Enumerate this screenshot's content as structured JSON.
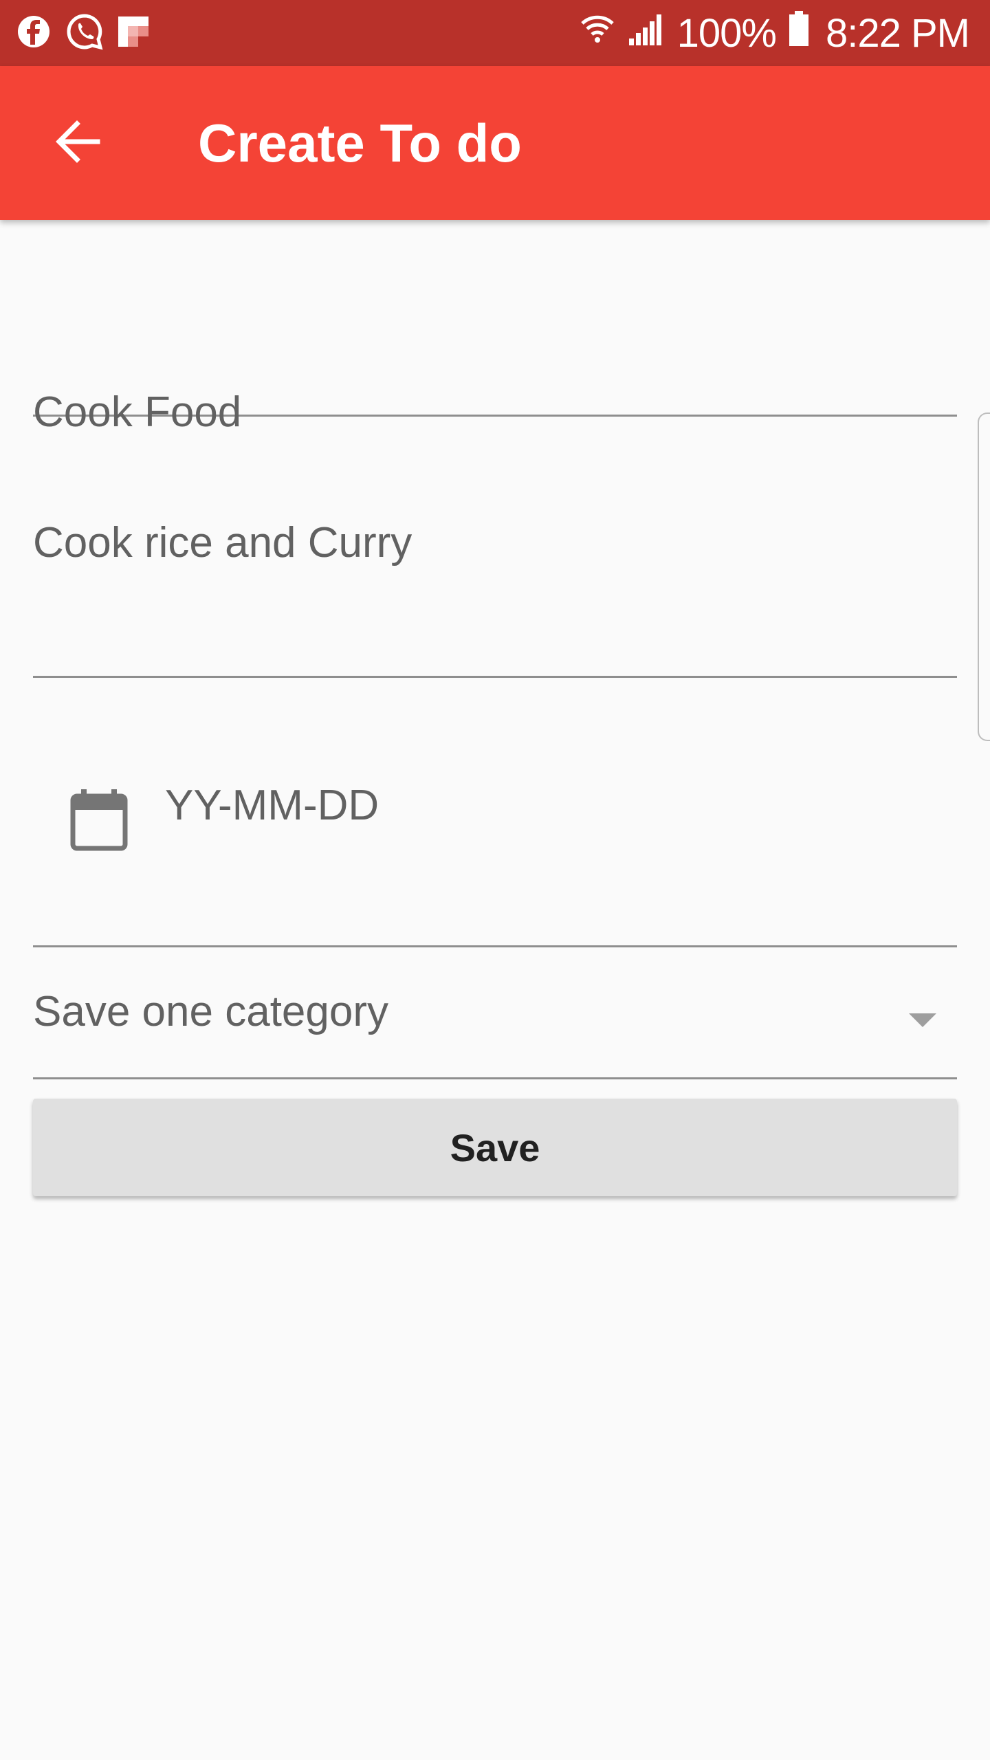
{
  "status_bar": {
    "icons": [
      "facebook-icon",
      "whatsapp-icon",
      "flipboard-icon",
      "wifi-icon",
      "signal-icon",
      "battery-icon"
    ],
    "battery_text": "100%",
    "time": "8:22 PM"
  },
  "app_bar": {
    "title": "Create To do",
    "back_icon": "arrow-left-icon",
    "color": "#f44336",
    "status_color": "#b8312a"
  },
  "form": {
    "title_value": "Cook Food",
    "description_value": "Cook rice and Curry",
    "date_icon": "calendar-icon",
    "date_placeholder": "YY-MM-DD",
    "category_placeholder": "Save one category",
    "save_label": "Save"
  }
}
